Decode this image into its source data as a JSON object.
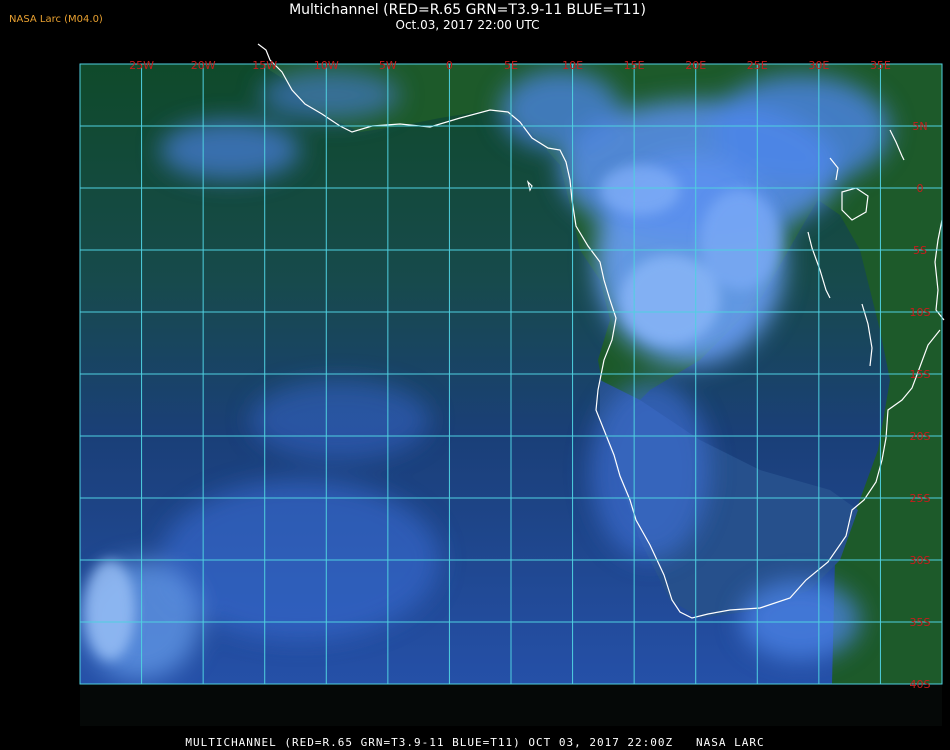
{
  "header": {
    "credit": "NASA Larc (M04.0)",
    "title": "Multichannel (RED=R.65 GRN=T3.9-11 BLUE=T11)",
    "subtitle": "Oct.03, 2017 22:00 UTC"
  },
  "footer": {
    "caption": "MULTICHANNEL (RED=R.65 GRN=T3.9-11 BLUE=T11) OCT 03, 2017 22:00Z   NASA LARC"
  },
  "map": {
    "lon_labels": [
      "25W",
      "20W",
      "15W",
      "10W",
      "5W",
      "0",
      "5E",
      "10E",
      "15E",
      "20E",
      "25E",
      "30E",
      "35E"
    ],
    "lat_labels": [
      "5N",
      "0",
      "5S",
      "10S",
      "15S",
      "20S",
      "25S",
      "30S",
      "35S",
      "40S"
    ],
    "colors": {
      "grid": "#4fd0e0",
      "label": "#c81c1c",
      "coast": "#ffffff",
      "ocean": "#1b3f7a",
      "land": "#1f5a2c",
      "cloud": "#4f88f0"
    }
  }
}
